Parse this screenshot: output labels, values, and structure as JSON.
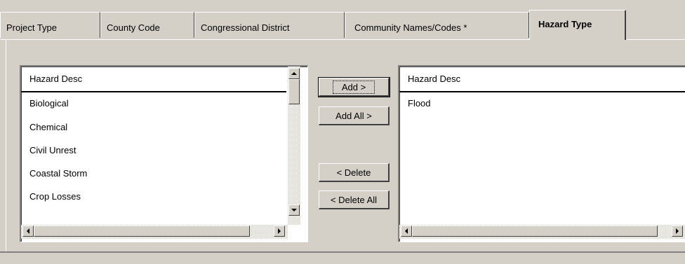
{
  "tabs": [
    {
      "label": "Project Type"
    },
    {
      "label": "County Code"
    },
    {
      "label": "Congressional District"
    },
    {
      "label": "Community Names/Codes *"
    },
    {
      "label": "Hazard Type",
      "active": true
    }
  ],
  "available": {
    "header": "Hazard Desc",
    "items": [
      "Biological",
      "Chemical",
      "Civil Unrest",
      "Coastal Storm",
      "Crop Losses"
    ]
  },
  "selected": {
    "header": "Hazard Desc",
    "items": [
      "Flood"
    ]
  },
  "buttons": {
    "add": "Add >",
    "add_all": "Add All >",
    "delete": "< Delete",
    "delete_all": "< Delete All"
  },
  "icons": {
    "scroll_up": "triangle-up",
    "scroll_down": "triangle-down",
    "scroll_left": "triangle-left",
    "scroll_right": "triangle-right"
  },
  "colors": {
    "face": "#d4d0c8",
    "list_bg": "#ffffff",
    "shadow": "#808080",
    "dark_shadow": "#404040"
  }
}
